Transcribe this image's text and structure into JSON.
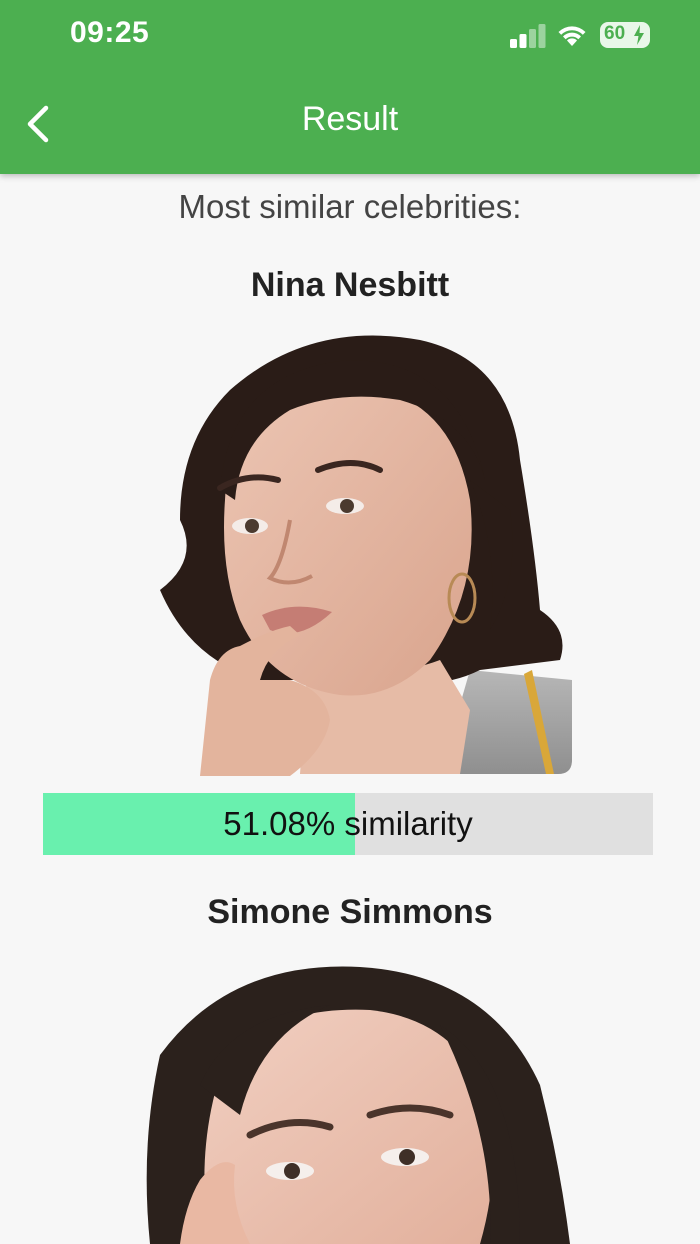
{
  "theme": {
    "appbar_color": "#4caf50",
    "page_background": "#f7f7f7",
    "similarity_fill_color": "#69f0ae",
    "similarity_track_color": "#e0e0e0"
  },
  "status_bar": {
    "time": "09:25",
    "battery_level": "60",
    "signal_icon": "cellular-signal-icon",
    "wifi_icon": "wifi-icon",
    "battery_icon": "battery-charging-icon"
  },
  "header": {
    "title": "Result",
    "back_icon": "chevron-left-icon"
  },
  "main": {
    "subtitle": "Most similar celebrities:",
    "results": [
      {
        "name": "Nina Nesbitt",
        "similarity_percent": 51.08,
        "similarity_label": "51.08% similarity"
      },
      {
        "name": "Simone Simmons"
      }
    ]
  }
}
